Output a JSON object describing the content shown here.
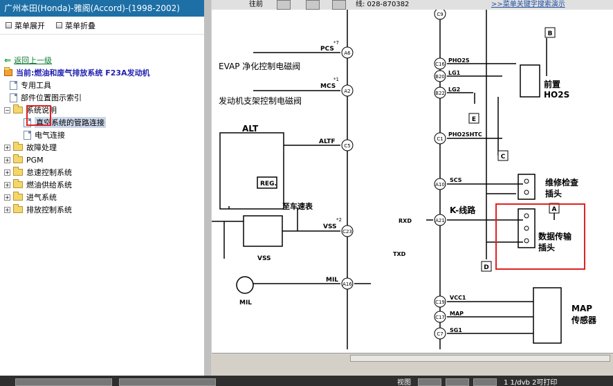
{
  "window": {
    "title": "广州本田(Honda)-雅阁(Accord)-(1998-2002)"
  },
  "toolbar": {
    "expand_label": "菜单展开",
    "collapse_label": "菜单折叠"
  },
  "tree": {
    "back_label": "返回上一级",
    "current_label": "当前:燃油和废气排放系统 F23A发动机",
    "items": [
      {
        "label": "专用工具",
        "type": "doc"
      },
      {
        "label": "部件位置图示索引",
        "type": "doc"
      },
      {
        "label": "系统说明",
        "type": "folder-open"
      },
      {
        "label": "真空系统的管路连接",
        "type": "doc",
        "selected": true
      },
      {
        "label": "电气连接",
        "type": "doc"
      },
      {
        "label": "故障处理",
        "type": "folder"
      },
      {
        "label": "PGM",
        "type": "folder"
      },
      {
        "label": "怠速控制系统",
        "type": "folder"
      },
      {
        "label": "燃油供给系统",
        "type": "folder"
      },
      {
        "label": "进气系统",
        "type": "folder"
      },
      {
        "label": "排放控制系统",
        "type": "folder"
      }
    ]
  },
  "topstrip": {
    "t1": "往前",
    "t2": "线: 028-870382",
    "t3": ">>菜单关键字搜索演示"
  },
  "diagram": {
    "left_labels": [
      "EVAP 净化控制电磁阀",
      "发动机支架控制电磁阀",
      "ALT",
      "REG.",
      "至车速表",
      "VSS",
      "MIL"
    ],
    "pins": [
      "PCS",
      "MCS",
      "ALTF",
      "VSS",
      "MIL",
      "PHO2S",
      "LG1",
      "LG2",
      "PHO2SHTC",
      "SCS",
      "RXD",
      "TXD",
      "VCC1",
      "MAP",
      "SG1"
    ],
    "pin_ids": [
      "A6",
      "A2",
      "C5",
      "C23",
      "A16",
      "C16",
      "B20",
      "B22",
      "C1",
      "A10",
      "A21",
      "C19",
      "C17",
      "C7",
      "C9"
    ],
    "right_labels": [
      "前置",
      "HO2S",
      "维修检查",
      "插头",
      "K-线路",
      "数据传输",
      "插头",
      "MAP",
      "传感器"
    ],
    "terminals": [
      "B",
      "C",
      "E",
      "A",
      "D"
    ],
    "superscripts": [
      "*7",
      "*1",
      "*2"
    ]
  },
  "status": {
    "view_label": "视图",
    "text": "1 1/dvb 2可打印"
  }
}
